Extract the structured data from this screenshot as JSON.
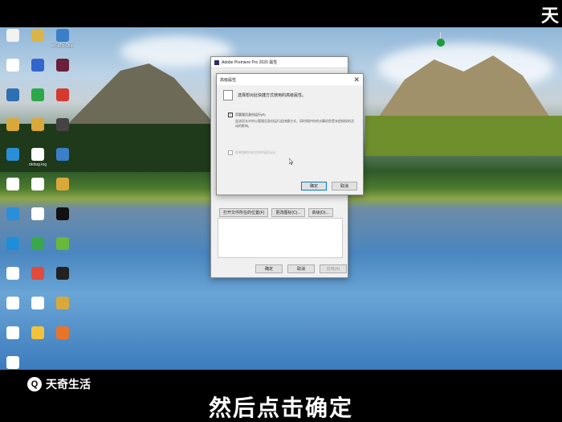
{
  "corner_brand": "天",
  "desktop_icons": [
    {
      "label": "",
      "color": "#f2f2f2"
    },
    {
      "label": "",
      "color": "#d9b44a"
    },
    {
      "label": "eo.aTg.Clop",
      "color": "#3a7fc8"
    },
    {
      "label": "",
      "color": "#ffffff"
    },
    {
      "label": "",
      "color": "#3366cc"
    },
    {
      "label": "",
      "color": "#6b1f3a"
    },
    {
      "label": "",
      "color": "#2f6fb3"
    },
    {
      "label": "",
      "color": "#2ca84a"
    },
    {
      "label": "",
      "color": "#d43a2f"
    },
    {
      "label": "",
      "color": "#d9a83a"
    },
    {
      "label": "",
      "color": "#d9a83a"
    },
    {
      "label": "",
      "color": "#444"
    },
    {
      "label": "",
      "color": "#2a8fd8"
    },
    {
      "label": "debug.log",
      "color": "#ffffff"
    },
    {
      "label": "",
      "color": "#3a7fc8"
    },
    {
      "label": "",
      "color": "#ffffff"
    },
    {
      "label": "",
      "color": "#ffffff"
    },
    {
      "label": "",
      "color": "#d9a83a"
    },
    {
      "label": "",
      "color": "#2a8fd8"
    },
    {
      "label": "",
      "color": "#ffffff"
    },
    {
      "label": "",
      "color": "#111"
    },
    {
      "label": "",
      "color": "#1d8fd8"
    },
    {
      "label": "",
      "color": "#3aa84a"
    },
    {
      "label": "",
      "color": "#6ab83a"
    },
    {
      "label": "",
      "color": "#ffffff"
    },
    {
      "label": "",
      "color": "#e24a3a"
    },
    {
      "label": "",
      "color": "#222"
    },
    {
      "label": "",
      "color": "#ffffff"
    },
    {
      "label": "",
      "color": "#ffffff"
    },
    {
      "label": "",
      "color": "#d9a83a"
    },
    {
      "label": "",
      "color": "#ffffff"
    },
    {
      "label": "",
      "color": "#f2c33a"
    },
    {
      "label": "",
      "color": "#e8742a"
    },
    {
      "label": "",
      "color": "#ffffff"
    }
  ],
  "properties_window": {
    "title": "Adobe Premiere Pro 2020 属性",
    "tabs_label": "",
    "field_label": "",
    "buttons": [
      "打开文件所在的位置(F)",
      "更改图标(C)...",
      "高级(D)..."
    ],
    "footer_buttons": [
      "确定",
      "取消",
      "应用(A)"
    ]
  },
  "advanced_dialog": {
    "title": "高级属性",
    "close_glyph": "✕",
    "description": "选择想对此快捷方式使用的高级属性。",
    "option1_label": "用管理员身份运行(R)",
    "option1_checked": true,
    "option1_note": "此选项允许你以管理员身份运行此快捷方式，同时保护你的计算机免受未经授权的活动的影响。",
    "option2_label": "在单独的内存空间中运行(M)",
    "option2_checked": false,
    "ok_label": "确定",
    "cancel_label": "取消"
  },
  "watermark": {
    "logo": "Q",
    "name": "天奇生活"
  },
  "subtitle": "然后点击确定"
}
